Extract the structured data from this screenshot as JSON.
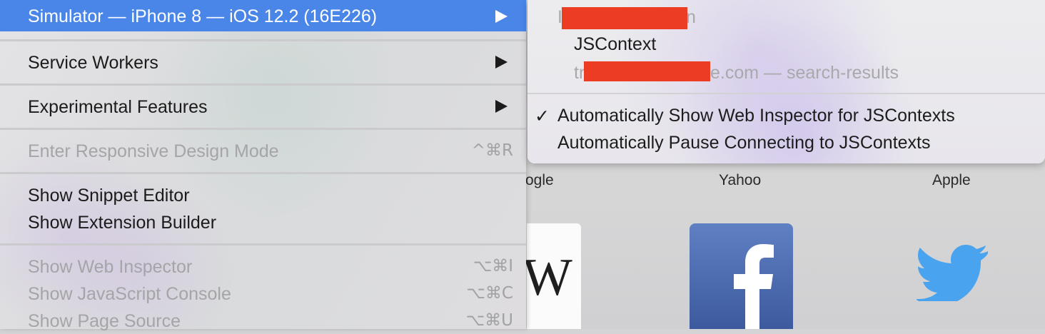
{
  "menu": {
    "simulator": "Simulator — iPhone 8 — iOS 12.2 (16E226)",
    "service_workers": "Service Workers",
    "experimental_features": "Experimental Features",
    "responsive_design": "Enter Responsive Design Mode",
    "responsive_design_shortcut": "^⌘R",
    "snippet_editor": "Show Snippet Editor",
    "extension_builder": "Show Extension Builder",
    "web_inspector": "Show Web Inspector",
    "web_inspector_shortcut": "⌥⌘I",
    "js_console": "Show JavaScript Console",
    "js_console_shortcut": "⌥⌘C",
    "page_source": "Show Page Source",
    "page_source_shortcut": "⌥⌘U"
  },
  "submenu": {
    "item1_visible_tail": "n",
    "item1_visible_head": "I",
    "jscontext": "JSContext",
    "item3_head": "tr",
    "item3_tail": "e.com — search-results",
    "checkmark": "✓",
    "auto_show": "Automatically Show Web Inspector for JSContexts",
    "auto_pause": "Automatically Pause Connecting to JSContexts"
  },
  "favorites": {
    "google_partial": "ogle",
    "yahoo": "Yahoo",
    "apple": "Apple",
    "wiki_glyph": "W"
  },
  "colors": {
    "highlight": "#4a86e8",
    "redaction": "#ec3c23",
    "facebook": "#3d5a9e",
    "twitter": "#4aa3ee"
  }
}
